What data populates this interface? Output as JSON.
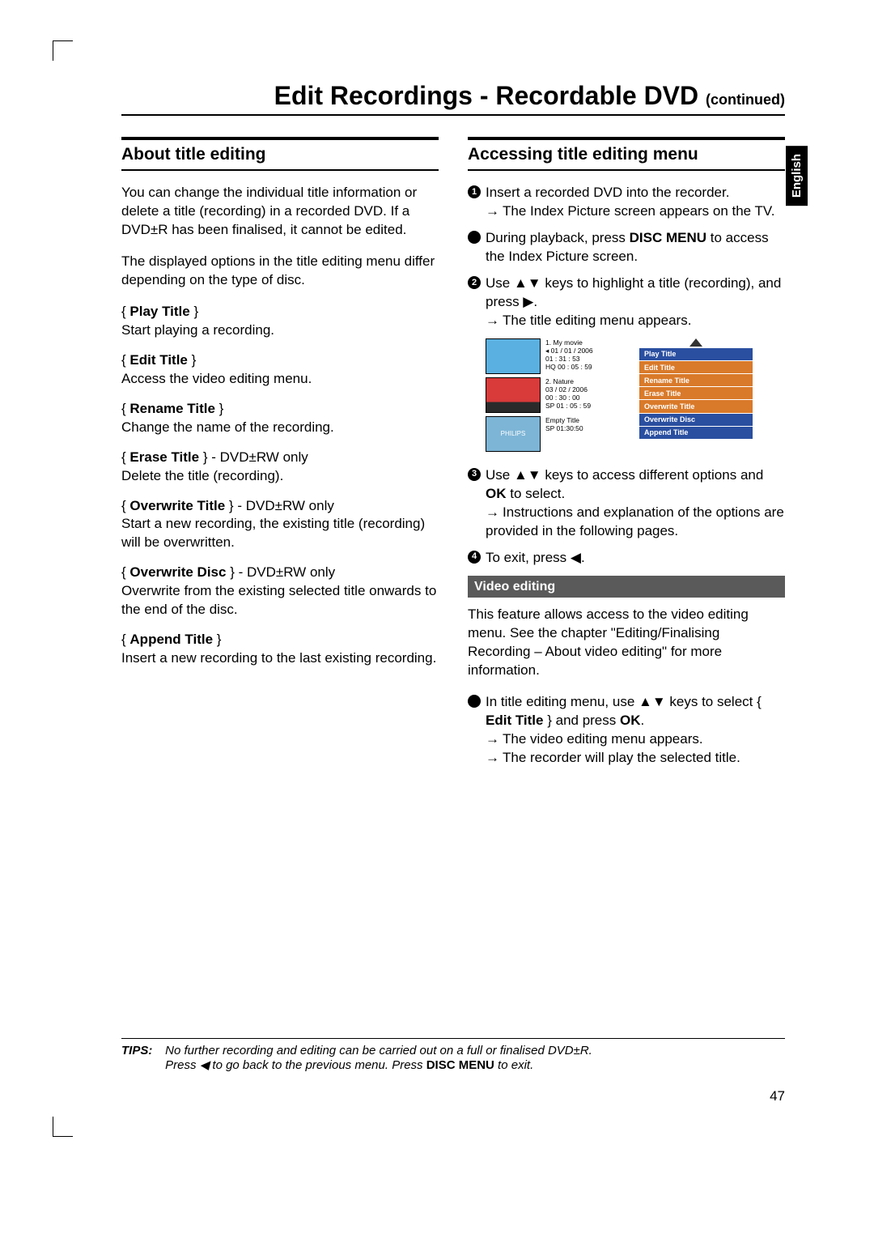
{
  "page": {
    "title_main": "Edit Recordings - Recordable DVD ",
    "title_cont": "(continued)",
    "language_tab": "English",
    "page_number": "47"
  },
  "left": {
    "heading": "About title editing",
    "intro1": "You can change the individual title information or delete a title (recording) in a recorded DVD. If a DVD±R has been finalised, it cannot be edited.",
    "intro2": "The displayed options in the title editing menu differ depending on the type of disc.",
    "options": [
      {
        "name": "Play Title",
        "suffix": "",
        "desc": "Start playing a recording."
      },
      {
        "name": "Edit Title",
        "suffix": "",
        "desc": "Access the video editing menu."
      },
      {
        "name": "Rename Title",
        "suffix": "",
        "desc": "Change the name of the recording."
      },
      {
        "name": "Erase Title",
        "suffix": " - DVD±RW only",
        "desc": "Delete the title (recording)."
      },
      {
        "name": "Overwrite Title",
        "suffix": " - DVD±RW only",
        "desc": "Start a new recording, the existing title (recording) will be overwritten."
      },
      {
        "name": "Overwrite Disc",
        "suffix": " - DVD±RW only",
        "desc": "Overwrite from the existing selected title onwards to the end of the disc."
      },
      {
        "name": "Append Title",
        "suffix": "",
        "desc": "Insert a new recording to the last existing recording."
      }
    ]
  },
  "right": {
    "heading": "Accessing title editing menu",
    "step1_main": "Insert a recorded DVD into the recorder.",
    "step1_sub": "The Index Picture screen appears on the TV.",
    "bullet_disc_menu_pre": "During playback, press ",
    "bullet_disc_menu_bold": "DISC MENU",
    "bullet_disc_menu_post": " to access the Index Picture screen.",
    "step2_main_pre": "Use ",
    "step2_main_mid": " keys to highlight a title (recording), and press ",
    "step2_sub": "The title editing menu appears.",
    "step3_main_pre": "Use ",
    "step3_main_mid": " keys to access different options and ",
    "step3_main_bold": "OK",
    "step3_main_post": " to select.",
    "step3_sub": "Instructions and explanation of the options are provided in the following pages.",
    "step4_main": "To exit, press ",
    "subheading": "Video editing",
    "video_para": "This feature allows access to the video editing menu. See the chapter \"Editing/Finalising Recording – About video editing\" for more information.",
    "video_bullet_pre": "In title editing menu, use ",
    "video_bullet_mid": " keys to select { ",
    "video_bullet_opt": "Edit Title",
    "video_bullet_post": " } and press ",
    "video_bullet_ok": "OK",
    "video_sub1": "The video editing menu appears.",
    "video_sub2": "The recorder will play the selected title."
  },
  "mini": {
    "entries": [
      {
        "title": "1. My movie",
        "date": "01 / 01 / 2006",
        "time": "01 : 31 : 53",
        "quality": "HQ  00 : 05 : 59"
      },
      {
        "title": "2. Nature",
        "date": "03 / 02 / 2006",
        "time": "00 : 30 : 00",
        "quality": "SP  01 : 05 : 59"
      },
      {
        "title": "Empty Title",
        "date": "SP 01:30:50",
        "time": "",
        "quality": ""
      }
    ],
    "menu": [
      "Play Title",
      "Edit Title",
      "Rename Title",
      "Erase Title",
      "Overwrite Title",
      "Overwrite Disc",
      "Append Title"
    ]
  },
  "tips": {
    "label": "TIPS:",
    "line1_pre": "No further recording and editing can be carried out on a full or finalised DVD±R.",
    "line2_pre": "Press ",
    "line2_post": " to go back to the previous menu. Press ",
    "line2_bold": "DISC MENU",
    "line2_end": " to exit."
  }
}
